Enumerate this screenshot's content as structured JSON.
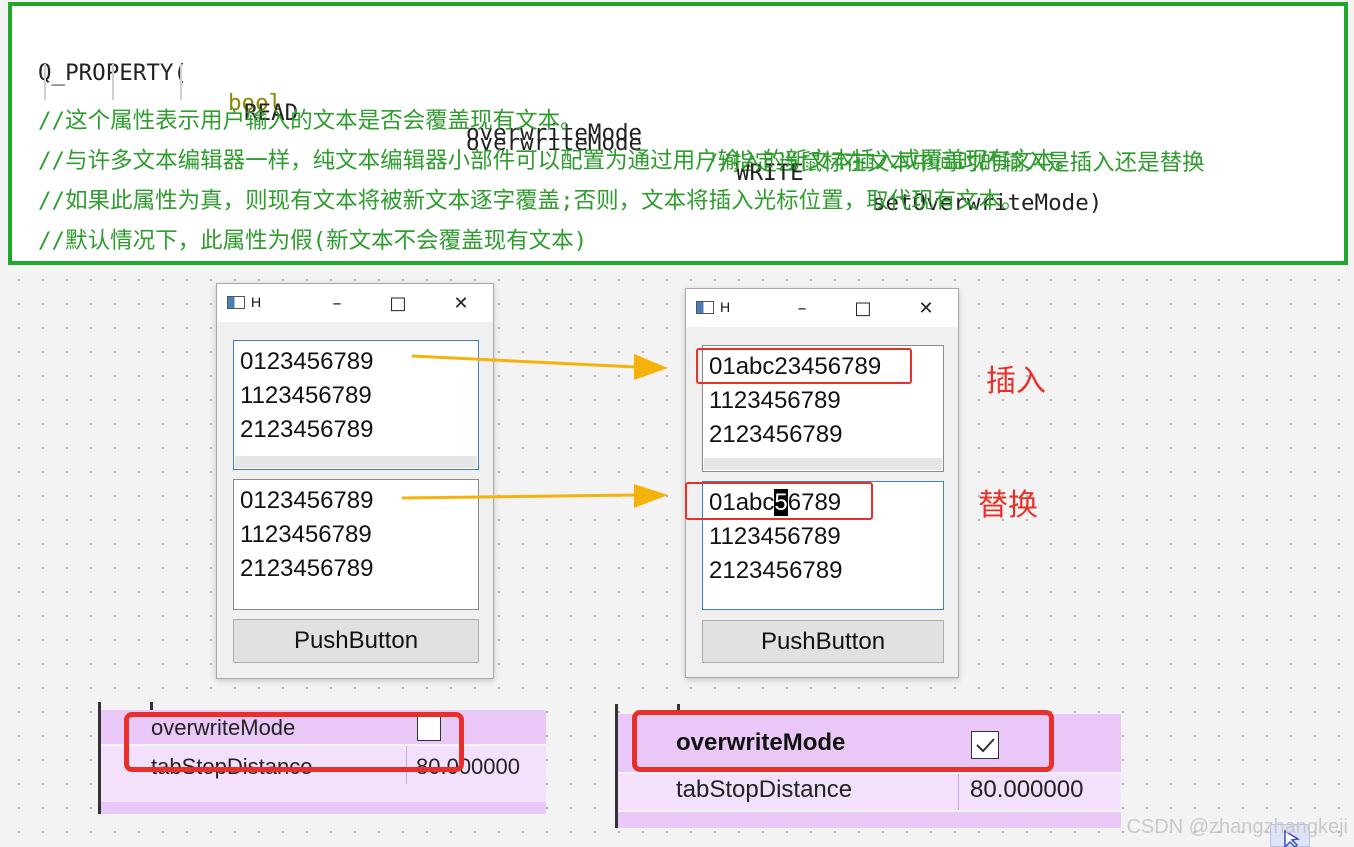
{
  "code": {
    "line1": {
      "macro": "Q_PROPERTY(",
      "type": "bool",
      "name": "overwriteMode",
      "comment": "//指定当鼠标在文本中间时的输入是插入还是替换"
    },
    "line2": {
      "read_kw": "READ",
      "getter": "overwriteMode",
      "write_kw": "WRITE",
      "setter": "setOverwriteMode)"
    },
    "comments": [
      "//这个属性表示用户输入的文本是否会覆盖现有文本。",
      "//与许多文本编辑器一样，纯文本编辑器小部件可以配置为通过用户输入的新文本插入或覆盖现有文本。",
      "//如果此属性为真，则现有文本将被新文本逐字覆盖;否则，文本将插入光标位置，取代现有文本。",
      "//默认情况下，此属性为假(新文本不会覆盖现有文本)"
    ]
  },
  "left_window": {
    "title": "H",
    "top_edit_lines": [
      "0123456789",
      "1123456789",
      "2123456789"
    ],
    "bottom_edit_lines": [
      "0123456789",
      "1123456789",
      "2123456789"
    ],
    "button": "PushButton"
  },
  "right_window": {
    "title": "H",
    "top_edit_lines": [
      "01abc23456789",
      "1123456789",
      "2123456789"
    ],
    "bottom_line1": {
      "before": "01abc",
      "cursor": "5",
      "after": "6789"
    },
    "bottom_edit_lines": [
      "1123456789",
      "2123456789"
    ],
    "button": "PushButton"
  },
  "labels": {
    "insert": "插入",
    "replace": "替换"
  },
  "left_props": {
    "rows": [
      {
        "name": "overwriteMode",
        "value": "",
        "checked": false
      },
      {
        "name": "tabStopDistance",
        "value": "80.000000"
      }
    ]
  },
  "right_props": {
    "rows": [
      {
        "name": "overwriteMode",
        "value": "",
        "checked": true
      },
      {
        "name": "tabStopDistance",
        "value": "80.000000"
      }
    ]
  },
  "watermark": "CSDN @zhangzhangkeji",
  "colors": {
    "highlight_border": "#21a72c",
    "annotation_red": "#e8302a",
    "arrow": "#f5b20a",
    "property_bg": "#e8c6f5"
  }
}
